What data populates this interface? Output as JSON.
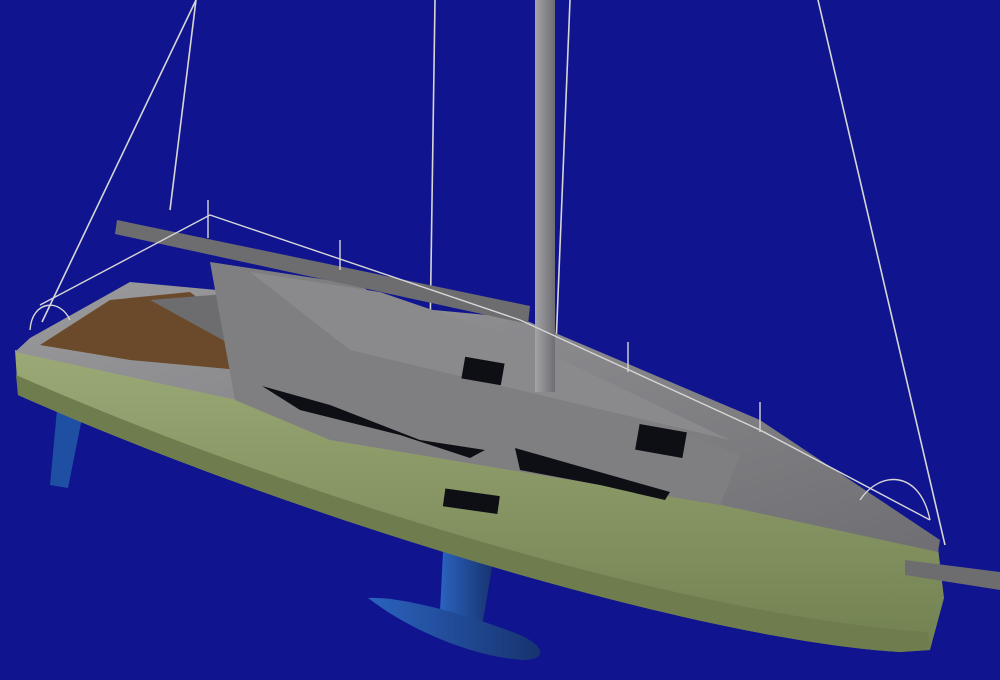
{
  "scene": {
    "subject": "sailboat",
    "colors": {
      "background": "#10158f",
      "hull": "#8f9e6b",
      "hull_shadow": "#6f7d4e",
      "deck": "#8a8a8c",
      "deck_dark": "#6d6d70",
      "cabin": "#7f7f82",
      "mast": "#8c8c90",
      "appendage": "#1f4fa3",
      "rigging": "#d6d6d6",
      "window": "#0e0f14",
      "cockpit_wood": "#6a4a2a"
    }
  }
}
